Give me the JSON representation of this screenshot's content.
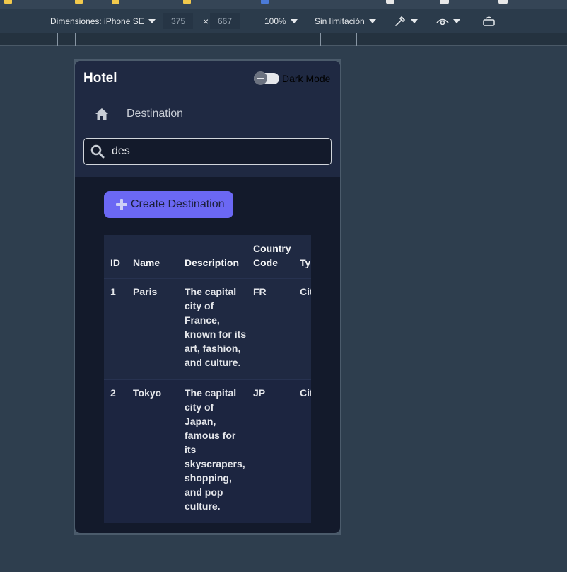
{
  "devtools": {
    "device_label": "Dimensiones: iPhone SE",
    "width_value": "375",
    "times_symbol": "×",
    "height_value": "667",
    "zoom": "100%",
    "throttle": "Sin limitación",
    "icons": [
      "color-picker-icon",
      "eye-icon",
      "rotate-icon"
    ]
  },
  "app": {
    "brand": "Hotel",
    "dark_mode_label": "Dark Mode",
    "breadcrumb": "Destination",
    "search_value": "des",
    "create_button_label": "Create Destination",
    "colors": {
      "header_bg": "#1f2942",
      "body_bg": "#131a2b",
      "accent": "#6b68f4"
    }
  },
  "table": {
    "headers": [
      "ID",
      "Name",
      "Description",
      "Country Code",
      "Type"
    ],
    "rows": [
      {
        "id": "1",
        "name": "Paris",
        "description": "The capital city of France, known for its art, fashion, and culture.",
        "country_code": "FR",
        "type": "City"
      },
      {
        "id": "2",
        "name": "Tokyo",
        "description": "The capital city of Japan, famous for its skyscrapers, shopping, and pop culture.",
        "country_code": "JP",
        "type": "City"
      }
    ]
  }
}
